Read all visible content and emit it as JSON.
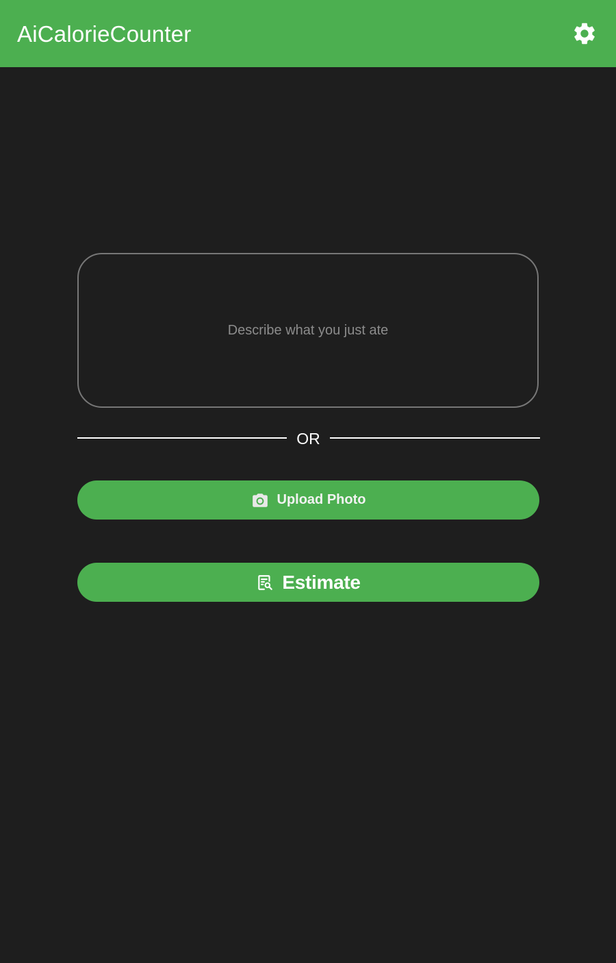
{
  "app_bar": {
    "title": "AiCalorieCounter",
    "settings_icon": "gear-icon",
    "background": "#4caf50"
  },
  "food_input": {
    "placeholder": "Describe what you just ate",
    "value": ""
  },
  "divider": {
    "label": "OR"
  },
  "upload_button": {
    "icon": "camera-icon",
    "label": "Upload Photo"
  },
  "estimate_button": {
    "icon": "document-search-icon",
    "label": "Estimate"
  },
  "colors": {
    "accent": "#4caf50",
    "background": "#1e1e1e",
    "input_border": "#777777",
    "placeholder": "#8c8c8c"
  }
}
